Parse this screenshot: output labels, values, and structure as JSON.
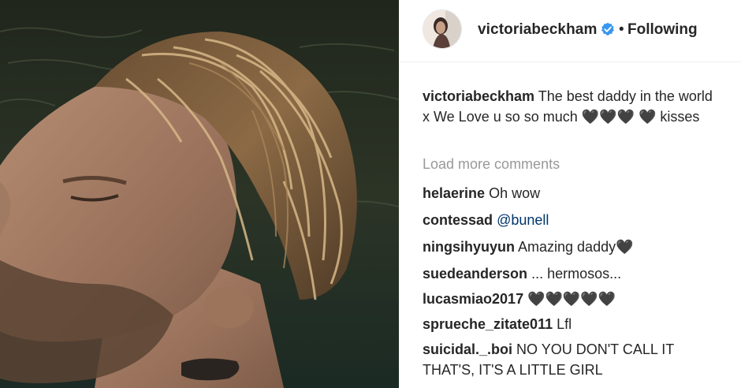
{
  "post": {
    "username": "victoriabeckham",
    "follow_status": "Following",
    "separator": "•",
    "caption_user": "victoriabeckham",
    "caption_text": "The best daddy in the world x We Love u so so much 🖤🖤🖤 🖤 kisses",
    "load_more": "Load more comments"
  },
  "comments": [
    {
      "user": "helaerine",
      "text": "Oh wow"
    },
    {
      "user": "contessad",
      "text": "@bunell"
    },
    {
      "user": "ningsihyuyun",
      "text": "Amazing daddy🖤"
    },
    {
      "user": "suedeanderson",
      "text": "... hermosos..."
    },
    {
      "user": "lucasmiao2017",
      "text": "🖤🖤🖤🖤🖤"
    },
    {
      "user": "sprueche_zitate011",
      "text": "Lfl"
    },
    {
      "user": "suicidal._.boi",
      "text": "NO YOU DON'T CALL IT THAT'S, IT'S A LITTLE GIRL"
    }
  ],
  "icons": {
    "verified": "verified-badge-icon",
    "avatar": "profile-avatar"
  },
  "colors": {
    "verified_blue": "#3897f0",
    "muted_text": "#999999",
    "mention": "#003569"
  }
}
